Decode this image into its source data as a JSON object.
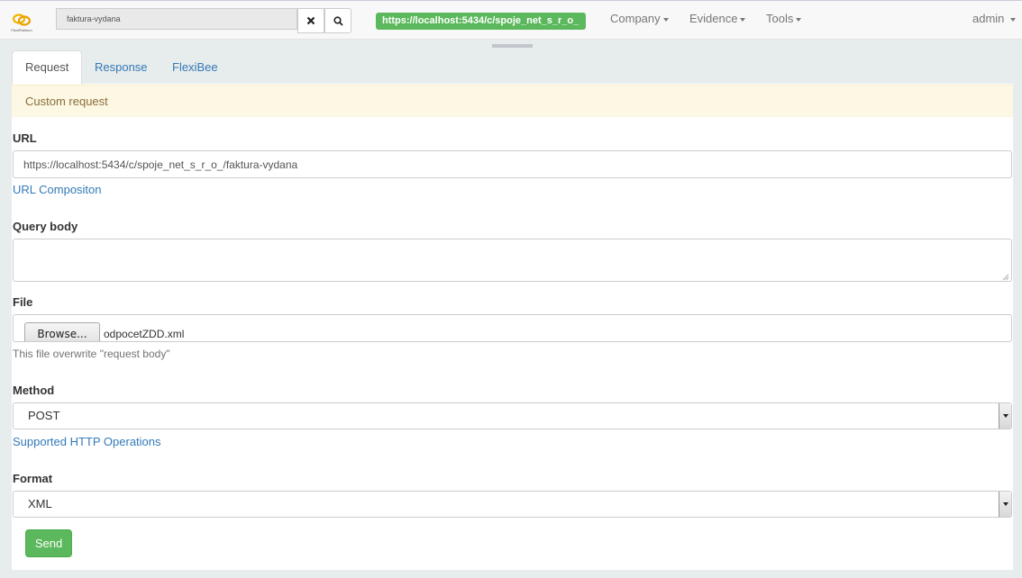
{
  "brand": {
    "logo_text": "FlexiPlatform"
  },
  "search": {
    "value": "faktura-vydana"
  },
  "topbar": {
    "url_badge": "https://localhost:5434/c/spoje_net_s_r_o_",
    "menus": [
      "Company",
      "Evidence",
      "Tools"
    ],
    "user": "admin"
  },
  "tabs": [
    "Request",
    "Response",
    "FlexiBee"
  ],
  "alert": "Custom request",
  "form": {
    "url_label": "URL",
    "url_value": "https://localhost:5434/c/spoje_net_s_r_o_/faktura-vydana",
    "url_link": "URL Compositon",
    "body_label": "Query body",
    "body_value": "",
    "file_label": "File",
    "browse_label": "Browse...",
    "file_name": "odpocetZDD.xml",
    "file_help": "This file overwrite \"request body\"",
    "method_label": "Method",
    "method_value": "POST",
    "method_link": "Supported HTTP Operations",
    "format_label": "Format",
    "format_value": "XML",
    "send_label": "Send"
  },
  "colors": {
    "brand_green": "#5cb85c",
    "link": "#337ab7",
    "alert_bg": "#fcf8e3"
  },
  "icons": [
    "flexiplatform-logo-icon",
    "close-icon",
    "search-icon",
    "caret-down-icon",
    "resize-grip-icon",
    "select-arrow-icon"
  ]
}
